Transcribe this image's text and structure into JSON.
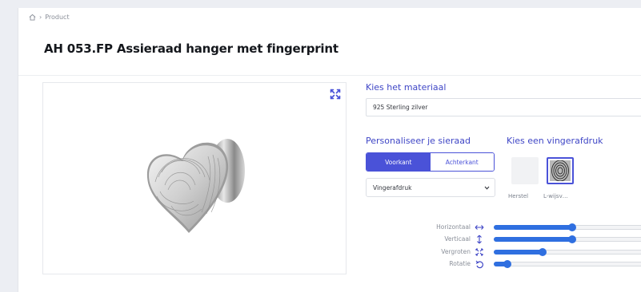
{
  "breadcrumb": {
    "current": "Product"
  },
  "product": {
    "title": "AH 053.FP Assieraad hanger met fingerprint"
  },
  "material": {
    "label": "Kies het materiaal",
    "value": "925 Sterling zilver"
  },
  "personalize": {
    "label": "Personaliseer je sieraad",
    "tabs": [
      {
        "label": "Voorkant",
        "active": true
      },
      {
        "label": "Achterkant",
        "active": false
      }
    ],
    "select_value": "Vingerafdruk"
  },
  "fingerprint": {
    "label": "Kies een vingerafdruk",
    "reset_label": "Herstel",
    "option_label": "L-wijsv…"
  },
  "sliders": [
    {
      "label": "Horizontaal",
      "icon": "arrows-horizontal-icon",
      "value": 0.5
    },
    {
      "label": "Verticaal",
      "icon": "arrows-vertical-icon",
      "value": 0.5
    },
    {
      "label": "Vergroten",
      "icon": "expand-icon",
      "value": 0.31
    },
    {
      "label": "Rotatie",
      "icon": "rotate-icon",
      "value": 0.08
    }
  ],
  "colors": {
    "accent": "#4a52d8",
    "slider": "#2f6fe0"
  }
}
